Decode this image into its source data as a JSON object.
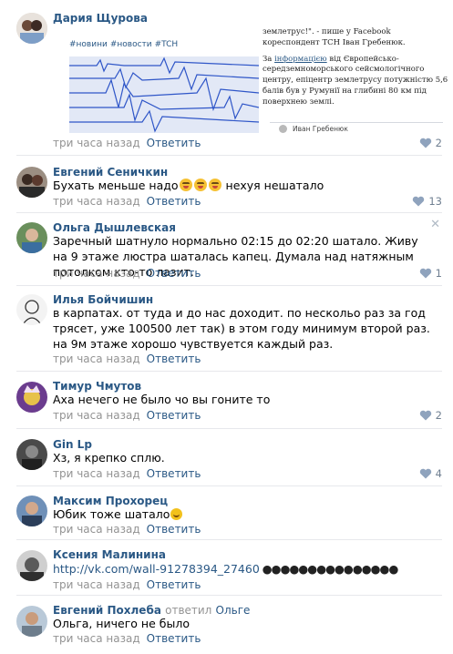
{
  "first_post": {
    "author": "Дария Щурова",
    "hashtags": [
      "#новини",
      "#новости",
      "#TCH"
    ],
    "article_p1": "землетрус!\". - пише у Facebook кореспондент ТСН Іван Гребенюк.",
    "article_p2_prefix": "За ",
    "article_p2_link": "інформацією",
    "article_p2_rest": " від Європейсько-середземноморського сейсмологічного центру, епіцентр землетрусу потужністю 5,6 балів був у Румунії на глибині 80 км під поверхнею землі.",
    "card_name": "Иван Гребенюк",
    "time": "три часа назад",
    "reply_label": "Ответить",
    "likes": "2"
  },
  "comments": [
    {
      "author": "Евгений Сеничкин",
      "text": "Бухать меньше надо",
      "text_after": " нехуя нешатало",
      "time": "три часа назад",
      "reply_label": "Ответить",
      "likes": "13"
    },
    {
      "author": "Ольга Дышлевская",
      "text": "Заречный шатнуло нормально 02:15 до 02:20 шатало. Живу на 9 этаже люстра шаталась капец. Думала над натяжным потолком кто-то лазит.",
      "time": "три часа назад",
      "reply_label": "Ответить",
      "likes": "1"
    },
    {
      "author": "Илья Бойчишин",
      "text": "в карпатах. от туда и до нас доходит. по нескольо раз за год трясет, уже 100500 лет так) в этом году минимум второй раз. на 9м этаже хорошо чувствуется каждый раз.",
      "time": "три часа назад",
      "reply_label": "Ответить",
      "likes": ""
    },
    {
      "author": "Тимур Чмутов",
      "text": "Аха нечего не было чо вы гоните то",
      "time": "три часа назад",
      "reply_label": "Ответить",
      "likes": "2"
    },
    {
      "author": "Gin Lp",
      "text": "Хз, я крепко сплю.",
      "time": "три часа назад",
      "reply_label": "Ответить",
      "likes": "4"
    },
    {
      "author": "Максим Прохорец",
      "text": "Юбик тоже шатало",
      "time": "три часа назад",
      "reply_label": "Ответить",
      "likes": ""
    },
    {
      "author": "Ксения Малинина",
      "text": "http://vk.com/wall-91278394_27460",
      "text_after": " ●●●●●●●●●●●●●●●",
      "time": "три часа назад",
      "reply_label": "Ответить",
      "likes": ""
    },
    {
      "author": "Евгений Похлеба",
      "reply_word": "ответил",
      "reply_to": "Ольге",
      "text": "Ольга, ничего не было",
      "time": "три часа назад",
      "reply_label": "Ответить",
      "likes": ""
    }
  ],
  "colors": {
    "link": "#2a5885",
    "meta": "#939393",
    "divider": "#e7e8ec",
    "like": "#8fa3bd"
  }
}
